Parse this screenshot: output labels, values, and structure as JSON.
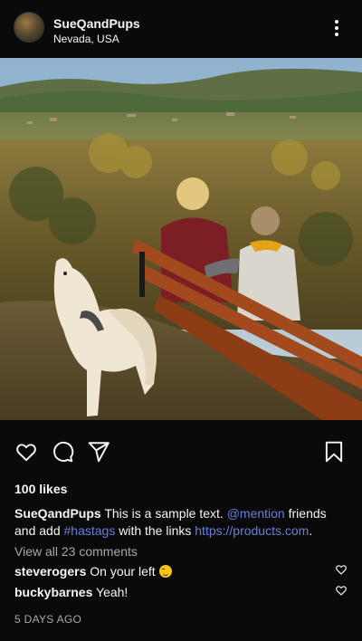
{
  "post": {
    "username": "SueQandPups",
    "location": "Nevada, USA",
    "likes": "100 likes",
    "caption": {
      "author": "SueQandPups",
      "text_1": " This is a sample text. ",
      "mention": "@mention",
      "text_2": " friends and add ",
      "hashtag": "#hastags",
      "text_3": " with the links ",
      "link": "https://products.com",
      "text_4": "."
    },
    "view_all_comments": "View all 23 comments",
    "comments": [
      {
        "user": "steverogers",
        "text": "On your left",
        "emoji": "wink-emoji"
      },
      {
        "user": "buckybarnes",
        "text": "Yeah!"
      }
    ],
    "timestamp": "5 DAYS AGO"
  },
  "icons": {
    "like": "heart-icon",
    "comment": "comment-bubble-icon",
    "share": "paper-plane-icon",
    "save": "bookmark-icon",
    "more": "more-vertical-icon"
  },
  "colors": {
    "background": "#0a0a0a",
    "text": "#f5f5f5",
    "muted": "#a8a8a8",
    "link": "#6b7fd9"
  }
}
